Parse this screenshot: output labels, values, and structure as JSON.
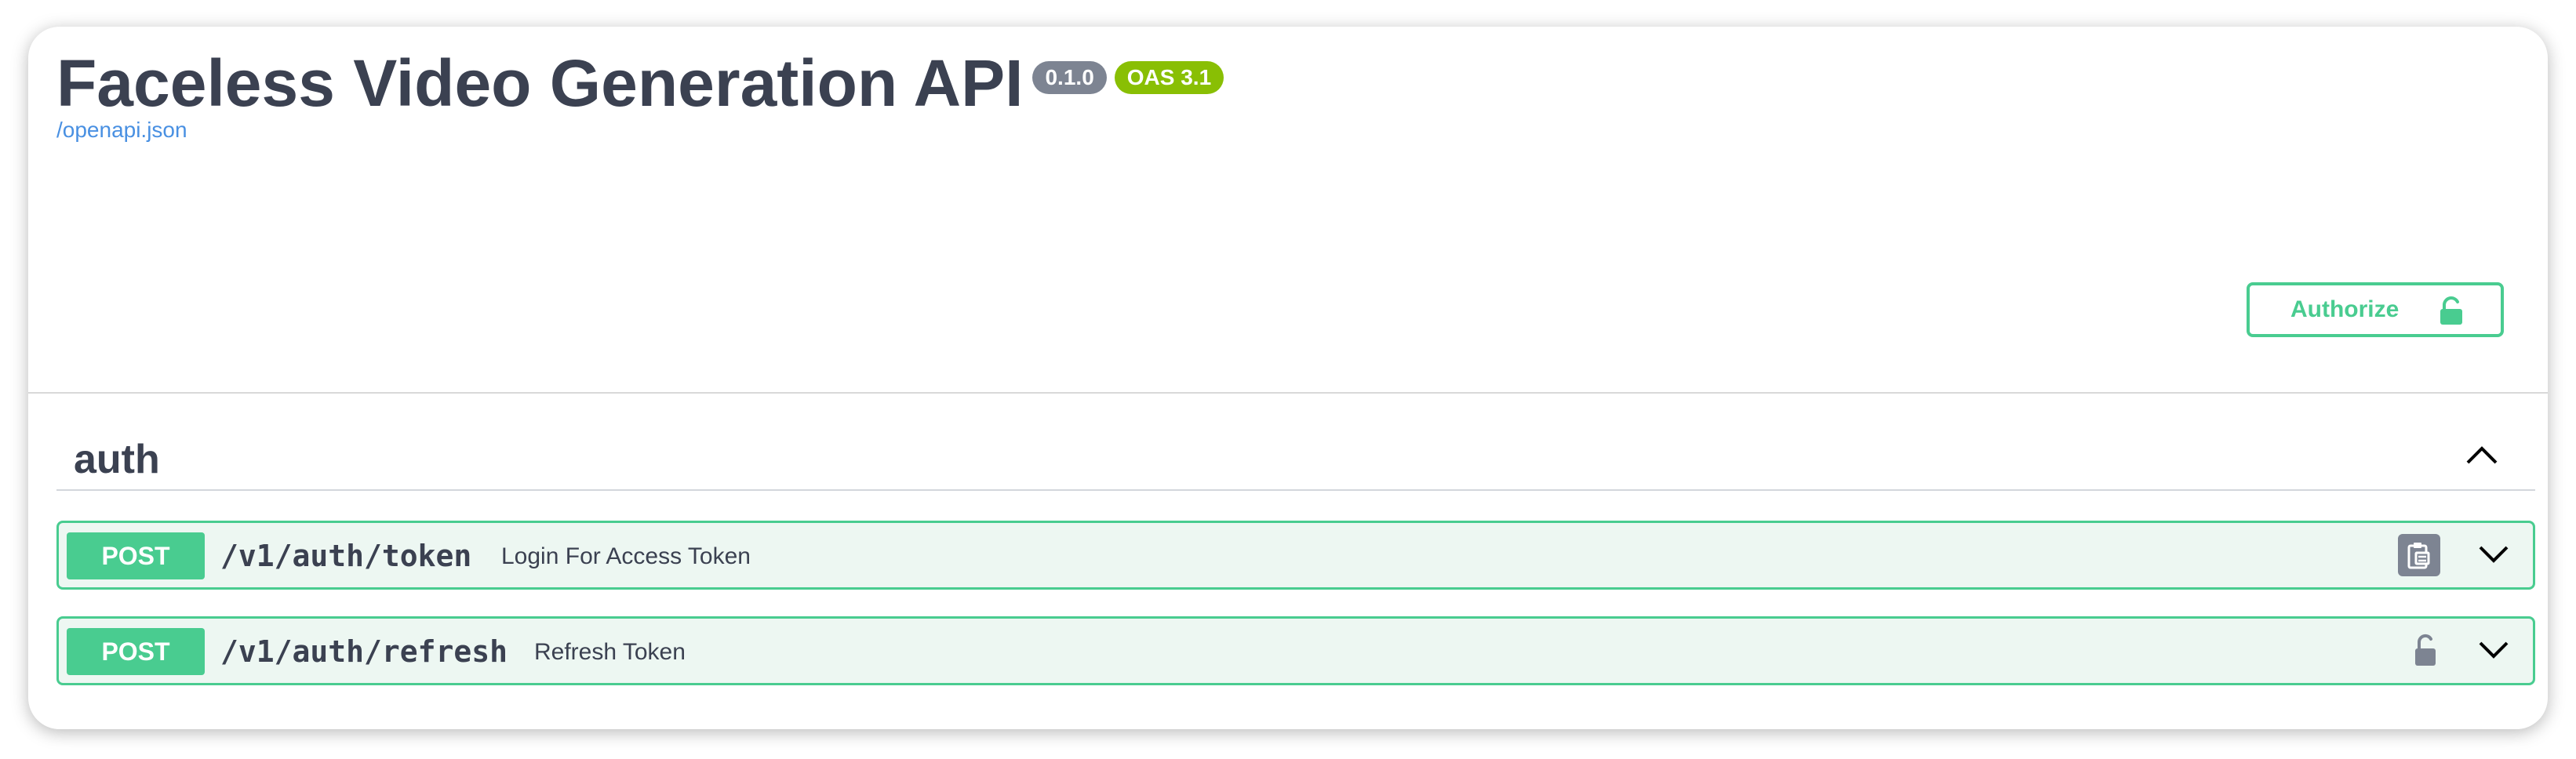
{
  "header": {
    "title": "Faceless Video Generation API",
    "version_badge": "0.1.0",
    "oas_badge": "OAS 3.1",
    "spec_link": "/openapi.json"
  },
  "authorize": {
    "label": "Authorize",
    "icon": "lock-open-icon"
  },
  "tags": [
    {
      "name": "auth",
      "expanded": true,
      "operations": [
        {
          "method": "POST",
          "path": "/v1/auth/token",
          "summary": "Login For Access Token",
          "action_icon": "copy-icon"
        },
        {
          "method": "POST",
          "path": "/v1/auth/refresh",
          "summary": "Refresh Token",
          "action_icon": "lock-open-icon"
        }
      ]
    }
  ],
  "colors": {
    "post": "#49cc90",
    "post_bg": "#edf7f2",
    "version_badge": "#7d8492",
    "oas_badge": "#89bf04",
    "link": "#4990e2",
    "text": "#3b4151"
  }
}
